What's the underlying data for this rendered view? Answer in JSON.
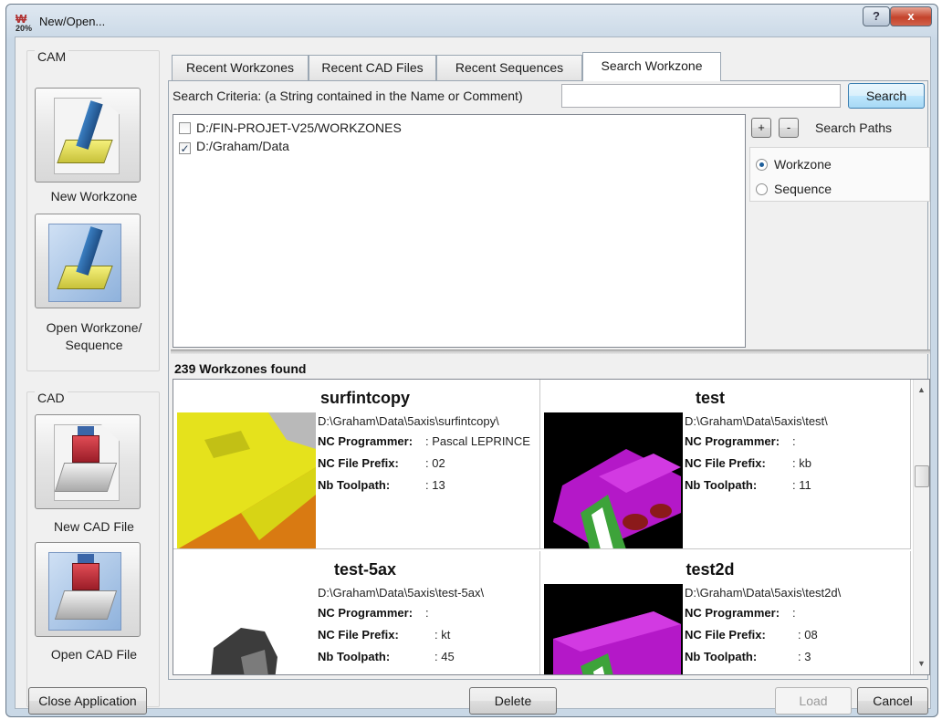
{
  "window": {
    "title": "New/Open...",
    "app_icon_text": "20%"
  },
  "sidebar": {
    "cam": {
      "label": "CAM",
      "new_workzone": "New Workzone",
      "open_workzone_line1": "Open Workzone/",
      "open_workzone_line2": "Sequence"
    },
    "cad": {
      "label": "CAD",
      "new_cad": "New CAD File",
      "open_cad": "Open CAD File"
    }
  },
  "tabs": [
    {
      "label": "Recent Workzones"
    },
    {
      "label": "Recent CAD Files"
    },
    {
      "label": "Recent Sequences"
    },
    {
      "label": "Search Workzone",
      "active": true
    }
  ],
  "search": {
    "criteria_label": "Search Criteria: (a String contained in the Name or Comment)",
    "criteria_value": "",
    "button": "Search"
  },
  "paths": [
    {
      "label": "D:/FIN-PROJET-V25/WORKZONES",
      "checked": false
    },
    {
      "label": "D:/Graham/Data",
      "checked": true
    }
  ],
  "path_controls": {
    "plus": "+",
    "minus": "-",
    "label": "Search Paths"
  },
  "search_type": {
    "options": [
      "Workzone",
      "Sequence"
    ],
    "selected": "Workzone"
  },
  "results": {
    "count_text": "239 Workzones found",
    "field_labels": {
      "programmer": "NC Programmer:",
      "prefix": "NC File Prefix:",
      "toolpaths": "Nb Toolpath:"
    },
    "items": [
      {
        "name": "surfintcopy",
        "path": "D:\\Graham\\Data\\5axis\\surfintcopy\\",
        "programmer": ": Pascal LEPRINCE",
        "prefix": ": 02",
        "toolpaths": ": 13"
      },
      {
        "name": "test",
        "path": "D:\\Graham\\Data\\5axis\\test\\",
        "programmer": ":",
        "prefix": ": kb",
        "toolpaths": ": 11"
      },
      {
        "name": "test-5ax",
        "path": "D:\\Graham\\Data\\5axis\\test-5ax\\",
        "programmer": ":",
        "prefix": ": kt",
        "toolpaths": ": 45"
      },
      {
        "name": "test2d",
        "path": "D:\\Graham\\Data\\5axis\\test2d\\",
        "programmer": ":",
        "prefix": ": 08",
        "toolpaths": ": 3"
      }
    ]
  },
  "footer": {
    "close_app": "Close Application",
    "delete": "Delete",
    "load": "Load",
    "cancel": "Cancel"
  },
  "window_controls": {
    "help": "?",
    "close": "x"
  }
}
